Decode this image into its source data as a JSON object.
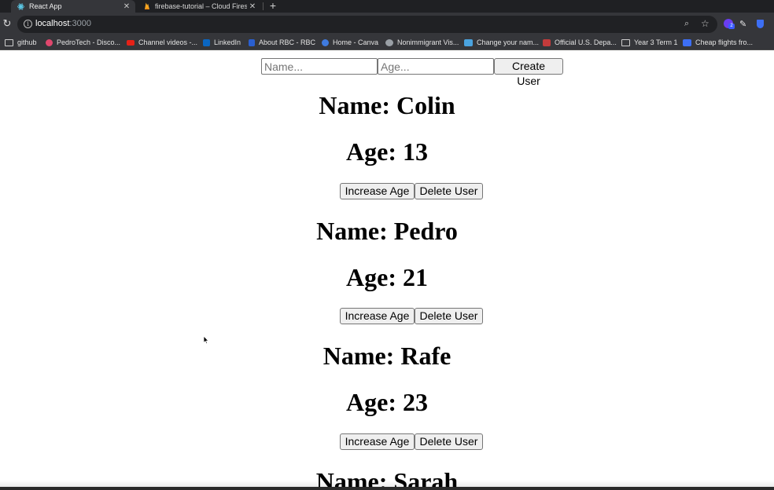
{
  "browser": {
    "tabs": [
      {
        "title": "React App",
        "active": true
      },
      {
        "title": "firebase-tutorial – Cloud Firest",
        "active": false
      }
    ],
    "url_host": "localhost",
    "url_port": ":3000",
    "bookmarks": [
      {
        "label": "github",
        "icon": "folder-icon"
      },
      {
        "label": "PedroTech - Disco...",
        "icon": "discord-icon"
      },
      {
        "label": "Channel videos -...",
        "icon": "youtube-icon"
      },
      {
        "label": "LinkedIn",
        "icon": "linkedin-icon"
      },
      {
        "label": "About RBC - RBC",
        "icon": "rbc-icon"
      },
      {
        "label": "Home - Canva",
        "icon": "canva-icon"
      },
      {
        "label": "Nonimmigrant Vis...",
        "icon": "site-icon"
      },
      {
        "label": "Change your nam...",
        "icon": "site-icon"
      },
      {
        "label": "Official U.S. Depa...",
        "icon": "seal-icon"
      },
      {
        "label": "Year 3 Term 1",
        "icon": "folder-icon"
      },
      {
        "label": "Cheap flights fro...",
        "icon": "flights-icon"
      }
    ],
    "extension_badge": "2"
  },
  "form": {
    "name_placeholder": "Name...",
    "age_placeholder": "Age...",
    "create_label": "Create User"
  },
  "users": [
    {
      "name": "Name: Colin",
      "age": "Age: 13"
    },
    {
      "name": "Name: Pedro",
      "age": "Age: 21"
    },
    {
      "name": "Name: Rafe",
      "age": "Age: 23"
    },
    {
      "name": "Name: Sarah",
      "age": ""
    }
  ],
  "user_actions": {
    "increase_label": "Increase Age",
    "delete_label": "Delete User"
  },
  "colors": {
    "chrome_dark": "#1f2023",
    "chrome_toolbar": "#35363a",
    "omnibox": "#202124",
    "button_bg": "#efefef"
  }
}
